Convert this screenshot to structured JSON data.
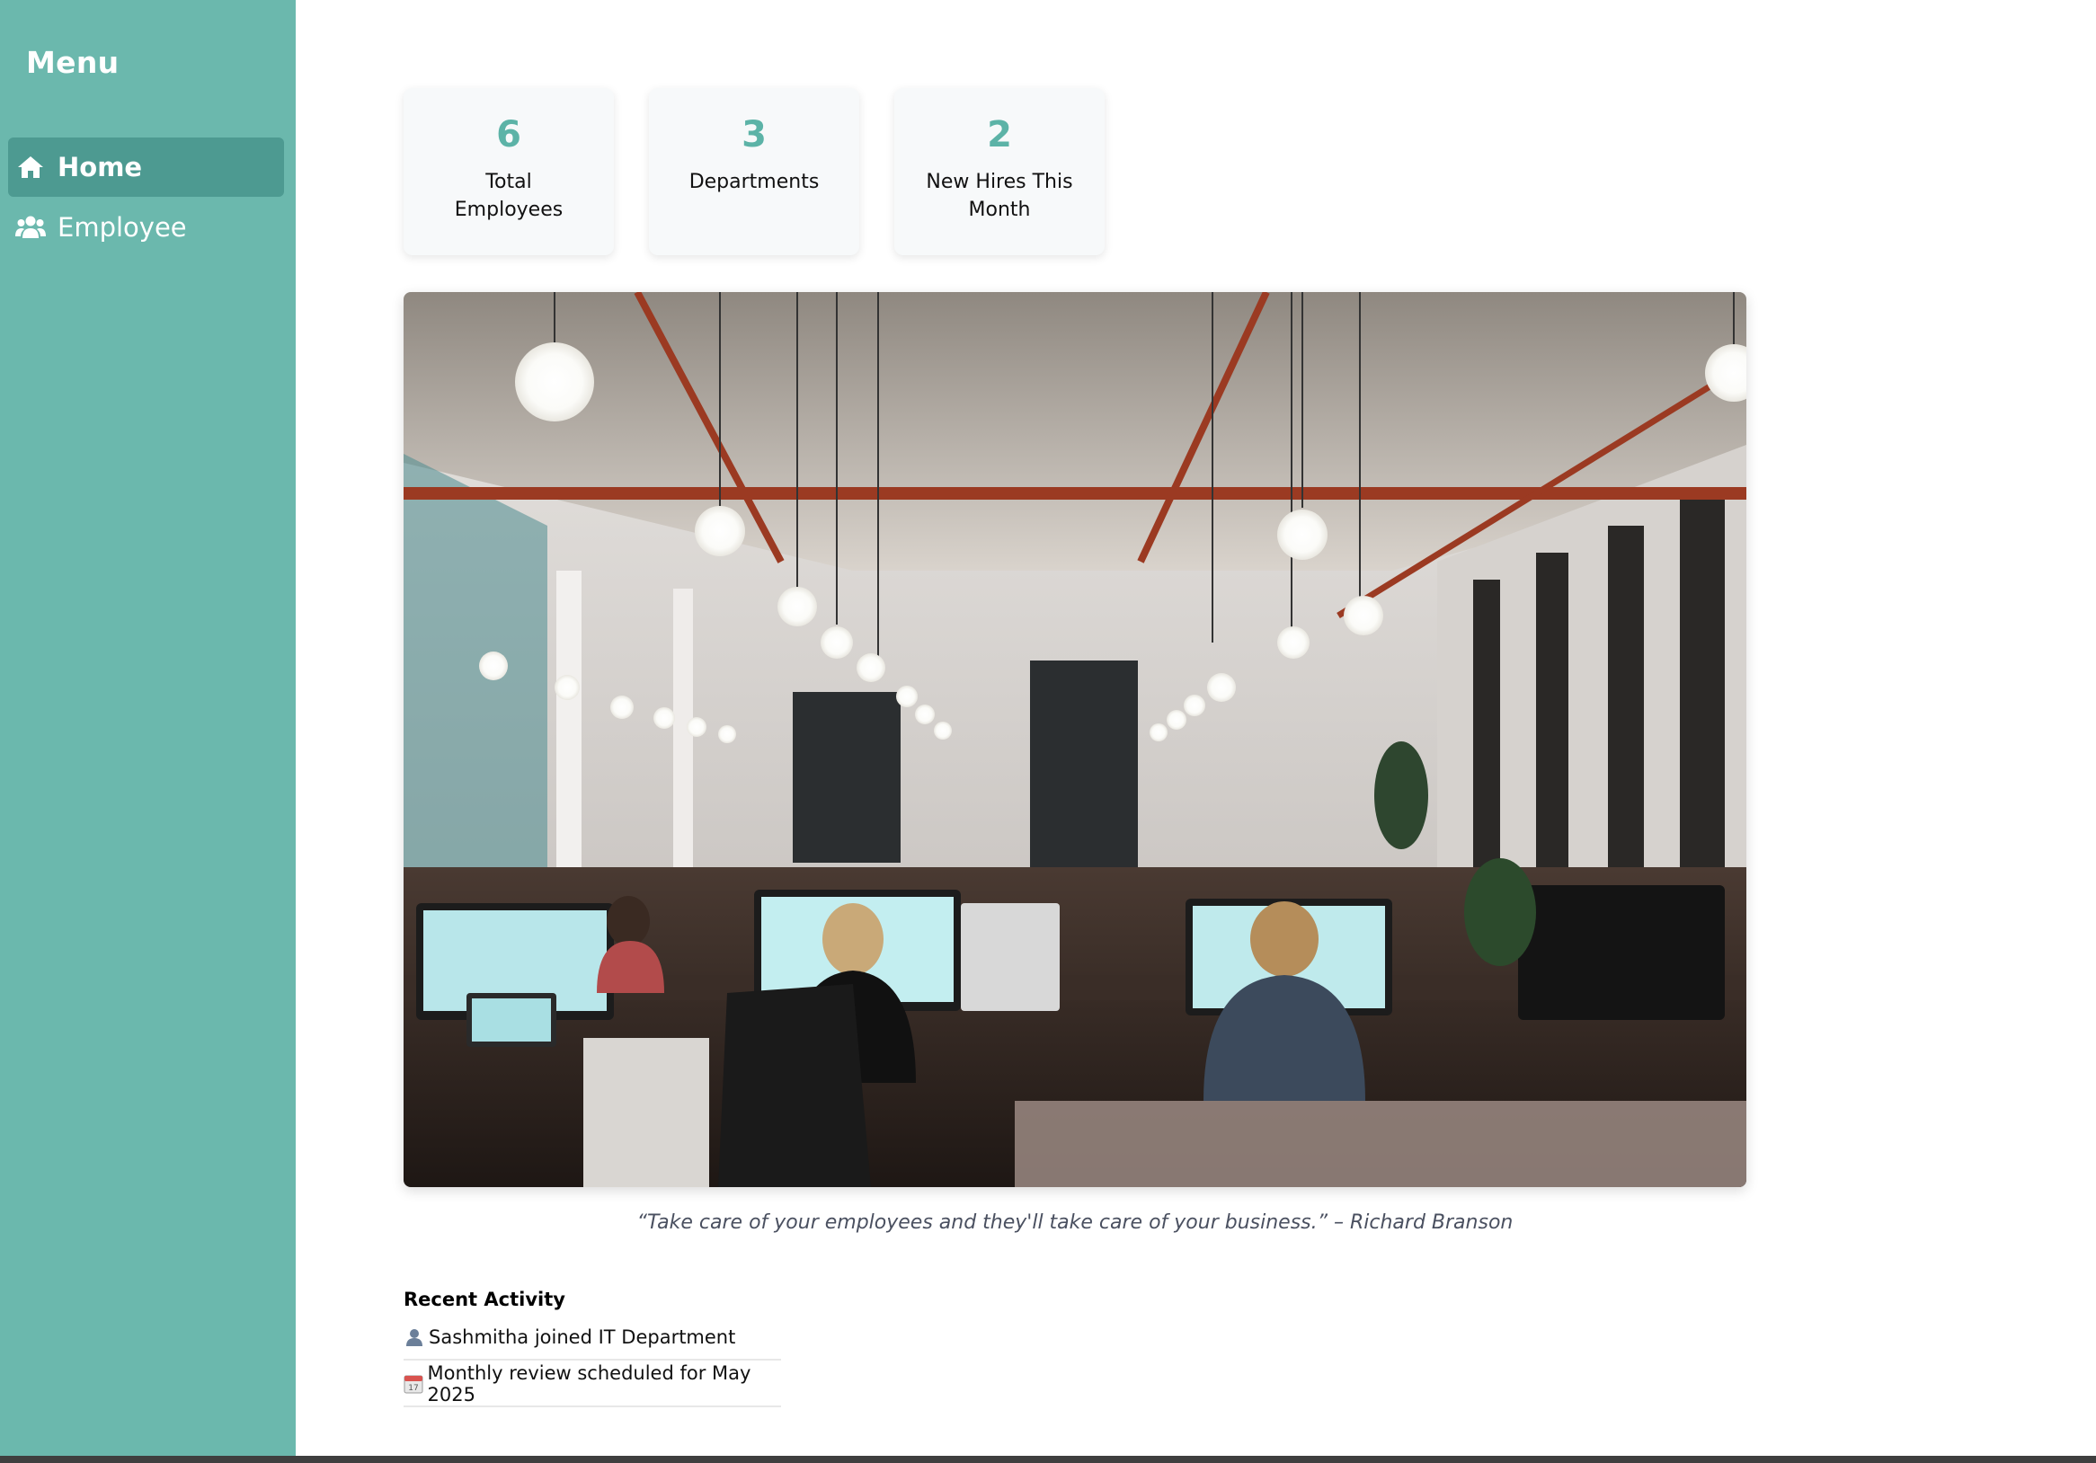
{
  "sidebar": {
    "title": "Menu",
    "items": [
      {
        "label": "Home",
        "icon": "home-icon",
        "active": true
      },
      {
        "label": "Employee",
        "icon": "users-icon",
        "active": false
      }
    ]
  },
  "stats": [
    {
      "value": "6",
      "label": "Total Employees"
    },
    {
      "value": "3",
      "label": "Departments"
    },
    {
      "value": "2",
      "label": "New Hires This Month"
    }
  ],
  "hero": {
    "image": "office-photo",
    "quote": "“Take care of your employees and they'll take care of your business.” – Richard Branson"
  },
  "activity": {
    "title": "Recent Activity",
    "items": [
      {
        "icon": "person-icon",
        "text": "Sashmitha joined IT Department"
      },
      {
        "icon": "calendar-icon",
        "text": "Monthly review scheduled for May 2025"
      }
    ]
  },
  "colors": {
    "sidebar": "#6bb8ad",
    "sidebar_active": "#4d9a91",
    "accent": "#5cb3a7"
  }
}
